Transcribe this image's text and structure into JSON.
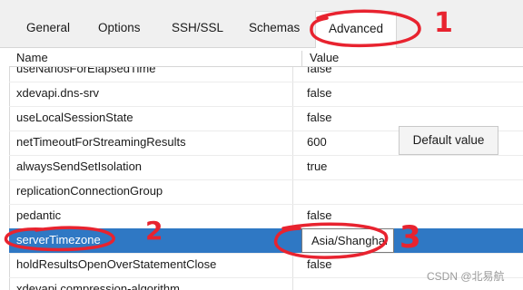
{
  "tabs": [
    {
      "label": "General",
      "active": false
    },
    {
      "label": "Options",
      "active": false
    },
    {
      "label": "SSH/SSL",
      "active": false
    },
    {
      "label": "Schemas",
      "active": false
    },
    {
      "label": "Advanced",
      "active": true
    }
  ],
  "table": {
    "columns": {
      "name": "Name",
      "value": "Value"
    },
    "rows": [
      {
        "name": "useNanosForElapsedTime",
        "value": "false"
      },
      {
        "name": "xdevapi.dns-srv",
        "value": "false"
      },
      {
        "name": "useLocalSessionState",
        "value": "false"
      },
      {
        "name": "netTimeoutForStreamingResults",
        "value": "600"
      },
      {
        "name": "alwaysSendSetIsolation",
        "value": "true"
      },
      {
        "name": "replicationConnectionGroup",
        "value": ""
      },
      {
        "name": "pedantic",
        "value": "false"
      },
      {
        "name": "serverTimezone",
        "value": "Asia/Shanghai",
        "selected": true,
        "editing": true
      },
      {
        "name": "holdResultsOpenOverStatementClose",
        "value": "false"
      },
      {
        "name": "xdevapi.compression-algorithm",
        "value": ""
      }
    ]
  },
  "default_value_button": "Default value",
  "annotations": [
    "1",
    "2",
    "3"
  ],
  "watermark": "CSDN @北易航",
  "colors": {
    "selection": "#2f78c4",
    "annotation": "#e8232f"
  }
}
